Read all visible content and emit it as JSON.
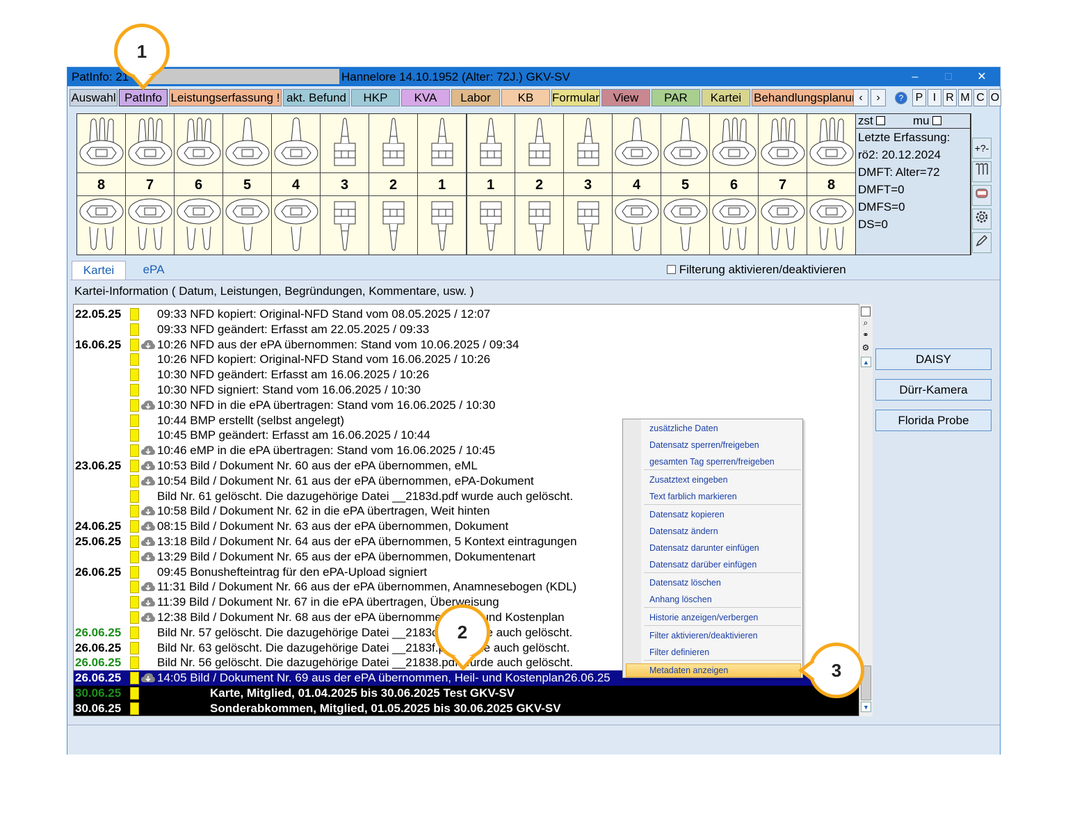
{
  "window": {
    "title_left": "PatInfo: 21",
    "title_patient": "Hannelore  14.10.1952 (Alter: 72J.)  GKV-SV",
    "ctl_min": "–",
    "ctl_max": "□",
    "ctl_close": "✕"
  },
  "tabs": [
    {
      "label": "Auswahl",
      "color": "#c9d3df"
    },
    {
      "label": "PatInfo",
      "color": "#c9a9e6"
    },
    {
      "label": "Leistungserfassung !",
      "color": "#f4b690"
    },
    {
      "label": "akt. Befund",
      "color": "#9ec9d6"
    },
    {
      "label": "HKP",
      "color": "#9ec9d6"
    },
    {
      "label": "KVA",
      "color": "#d6a7e6"
    },
    {
      "label": "Labor",
      "color": "#dfb98a"
    },
    {
      "label": "KB",
      "color": "#f4cba4"
    },
    {
      "label": "Formular",
      "color": "#e8df8a"
    },
    {
      "label": "View",
      "color": "#c9878f"
    },
    {
      "label": "PAR",
      "color": "#a9cf8f"
    },
    {
      "label": "Kartei",
      "color": "#d8d58f"
    },
    {
      "label": "Behandlungsplanung",
      "color": "#f4b690"
    }
  ],
  "nav": {
    "prev": "‹",
    "next": "›",
    "help": "?",
    "p": "P",
    "i": "I",
    "r": "R",
    "m": "M",
    "c": "C",
    "o": "O"
  },
  "teeth": {
    "upper_numbers": [
      "8",
      "7",
      "6",
      "5",
      "4",
      "3",
      "2",
      "1",
      "1",
      "2",
      "3",
      "4",
      "5",
      "6",
      "7",
      "8"
    ]
  },
  "info_panel": {
    "zst": "zst",
    "mu": "mu",
    "line1": "Letzte Erfassung:",
    "line2": "rö2: 20.12.2024",
    "line3": "DMFT: Alter=72",
    "line4": "DMFT=0",
    "line5": "DMFS=0",
    "line6": "DS=0",
    "side_btn1": "+?-"
  },
  "subtabs": {
    "kartei": "Kartei",
    "epa": "ePA",
    "filter": "Filterung aktivieren/deaktivieren"
  },
  "kartei_info": "Kartei-Information ( Datum, Leistungen, Begründungen, Kommentare, usw. )",
  "rows": [
    {
      "date": "22.05.25",
      "cloud": false,
      "text": "09:33 NFD kopiert: Original-NFD Stand vom 08.05.2025 / 12:07"
    },
    {
      "date": "",
      "cloud": false,
      "text": "09:33 NFD geändert: Erfasst am 22.05.2025 / 09:33"
    },
    {
      "date": "16.06.25",
      "cloud": true,
      "text": "10:26 NFD aus der ePA übernommen: Stand vom 10.06.2025 / 09:34"
    },
    {
      "date": "",
      "cloud": false,
      "text": "10:26 NFD kopiert: Original-NFD Stand vom 16.06.2025 / 10:26"
    },
    {
      "date": "",
      "cloud": false,
      "text": "10:30 NFD geändert: Erfasst am 16.06.2025 / 10:26"
    },
    {
      "date": "",
      "cloud": false,
      "text": "10:30 NFD signiert: Stand vom 16.06.2025 / 10:30"
    },
    {
      "date": "",
      "cloud": true,
      "text": "10:30 NFD in die ePA übertragen: Stand vom 16.06.2025 / 10:30"
    },
    {
      "date": "",
      "cloud": false,
      "text": "10:44 BMP erstellt (selbst angelegt)"
    },
    {
      "date": "",
      "cloud": false,
      "text": "10:45 BMP geändert: Erfasst am 16.06.2025 / 10:44"
    },
    {
      "date": "",
      "cloud": true,
      "text": "10:46 eMP in die ePA übertragen: Stand vom 16.06.2025 / 10:45"
    },
    {
      "date": "23.06.25",
      "cloud": true,
      "text": "10:53 Bild / Dokument Nr. 60 aus der ePA übernommen, eML"
    },
    {
      "date": "",
      "cloud": true,
      "text": "10:54 Bild / Dokument Nr. 61 aus der ePA übernommen, ePA-Dokument"
    },
    {
      "date": "",
      "cloud": false,
      "text": "Bild Nr. 61 gelöscht. Die dazugehörige Datei __2183d.pdf wurde auch gelöscht."
    },
    {
      "date": "",
      "cloud": true,
      "text": "10:58 Bild / Dokument Nr. 62 in die ePA übertragen, Weit hinten"
    },
    {
      "date": "24.06.25",
      "cloud": true,
      "text": "08:15 Bild / Dokument Nr. 63 aus der ePA übernommen, Dokument"
    },
    {
      "date": "25.06.25",
      "cloud": true,
      "text": "13:18 Bild / Dokument Nr. 64 aus der ePA übernommen, 5 Kontext eintragungen"
    },
    {
      "date": "",
      "cloud": true,
      "text": "13:29 Bild / Dokument Nr. 65 aus der ePA übernommen, Dokumentenart"
    },
    {
      "date": "26.06.25",
      "cloud": false,
      "text": "09:45 Bonushefteintrag für den ePA-Upload signiert"
    },
    {
      "date": "",
      "cloud": true,
      "text": "11:31 Bild / Dokument Nr. 66 aus der ePA übernommen, Anamnesebogen (KDL)"
    },
    {
      "date": "",
      "cloud": true,
      "text": "11:39 Bild / Dokument Nr. 67 in die ePA übertragen, Überweisung"
    },
    {
      "date": "",
      "cloud": true,
      "text": "12:38 Bild / Dokument Nr. 68 aus der ePA übernommen, Heil- und Kostenplan"
    },
    {
      "date": "26.06.25",
      "green": true,
      "cloud": false,
      "text": "Bild Nr. 57 gelöscht. Die dazugehörige Datei __2183c.pdf wurde auch gelöscht."
    },
    {
      "date": "26.06.25",
      "cloud": false,
      "text": "Bild Nr. 63 gelöscht. Die dazugehörige Datei __2183f.pdf wurde auch gelöscht."
    },
    {
      "date": "26.06.25",
      "green": true,
      "cloud": false,
      "text": "Bild Nr. 56 gelöscht. Die dazugehörige Datei __21838.pdf wurde auch gelöscht."
    },
    {
      "date": "26.06.25",
      "cloud": true,
      "selected": true,
      "text": "14:05 Bild / Dokument Nr. 69 aus der ePA übernommen, Heil- und Kostenplan26.06.25"
    },
    {
      "date": "30.06.25",
      "green": true,
      "black": true,
      "cloud": false,
      "text": "Karte, Mitglied, 01.04.2025 bis 30.06.2025  Test GKV-SV"
    },
    {
      "date": "30.06.25",
      "black": true,
      "cloud": false,
      "text": "Sonderabkommen, Mitglied, 01.05.2025 bis 30.06.2025  GKV-SV"
    }
  ],
  "right_buttons": {
    "daisy": "DAISY",
    "duerr": "Dürr-Kamera",
    "florida": "Florida Probe"
  },
  "context_menu": [
    "zusätzliche Daten",
    "Datensatz sperren/freigeben",
    "gesamten Tag sperren/freigeben",
    "Zusatztext eingeben",
    "Text farblich markieren",
    "Datensatz kopieren",
    "Datensatz ändern",
    "Datensatz darunter einfügen",
    "Datensatz darüber einfügen",
    "Datensatz löschen",
    "Anhang löschen",
    "Historie anzeigen/verbergen",
    "Filter aktivieren/deaktivieren",
    "Filter definieren",
    "Metadaten anzeigen"
  ],
  "callouts": {
    "c1": "1",
    "c2": "2",
    "c3": "3"
  },
  "colors": {
    "accent_orange": "#f7a81b",
    "selection": "#0a0a8c",
    "date_green": "#1a8f1a"
  }
}
